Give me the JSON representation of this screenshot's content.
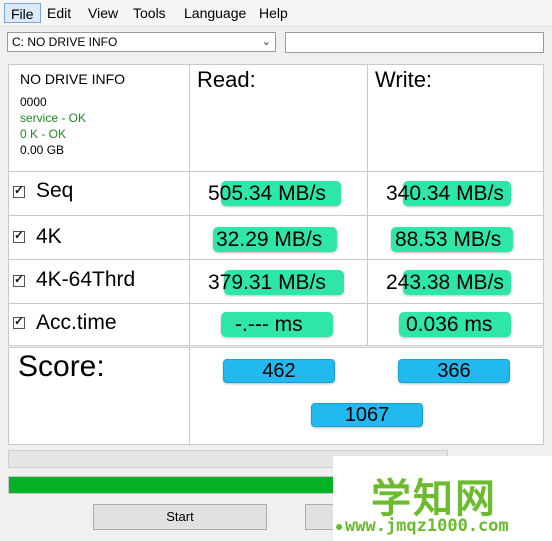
{
  "menu": {
    "items": [
      "File",
      "Edit",
      "View",
      "Tools",
      "Language",
      "Help"
    ]
  },
  "drive": {
    "selected": "C: NO DRIVE INFO",
    "text_value": ""
  },
  "info": {
    "title": "NO DRIVE INFO",
    "id": "0000",
    "service": "service - OK",
    "alignment": "0 K - OK",
    "size": "0.00 GB"
  },
  "headers": {
    "read": "Read:",
    "write": "Write:"
  },
  "tests": [
    {
      "label": "Seq",
      "checked": true,
      "read": "505.34 MB/s",
      "write": "340.34 MB/s"
    },
    {
      "label": "4K",
      "checked": true,
      "read": "32.29 MB/s",
      "write": "88.53 MB/s"
    },
    {
      "label": "4K-64Thrd",
      "checked": true,
      "read": "379.31 MB/s",
      "write": "243.38 MB/s"
    },
    {
      "label": "Acc.time",
      "checked": true,
      "read": "-.--- ms",
      "write": "0.036 ms"
    }
  ],
  "score": {
    "label": "Score:",
    "read": "462",
    "write": "366",
    "total": "1067"
  },
  "progress": {
    "percent": 100
  },
  "buttons": {
    "start": "Start"
  },
  "watermark": {
    "cn": "学知网",
    "url": "www.jmqz1000.com"
  },
  "colors": {
    "green_highlight": "#2ee6a8",
    "score_blue": "#22b9ee",
    "progress_green": "#06b025",
    "ok_text": "#1f8c1f"
  }
}
